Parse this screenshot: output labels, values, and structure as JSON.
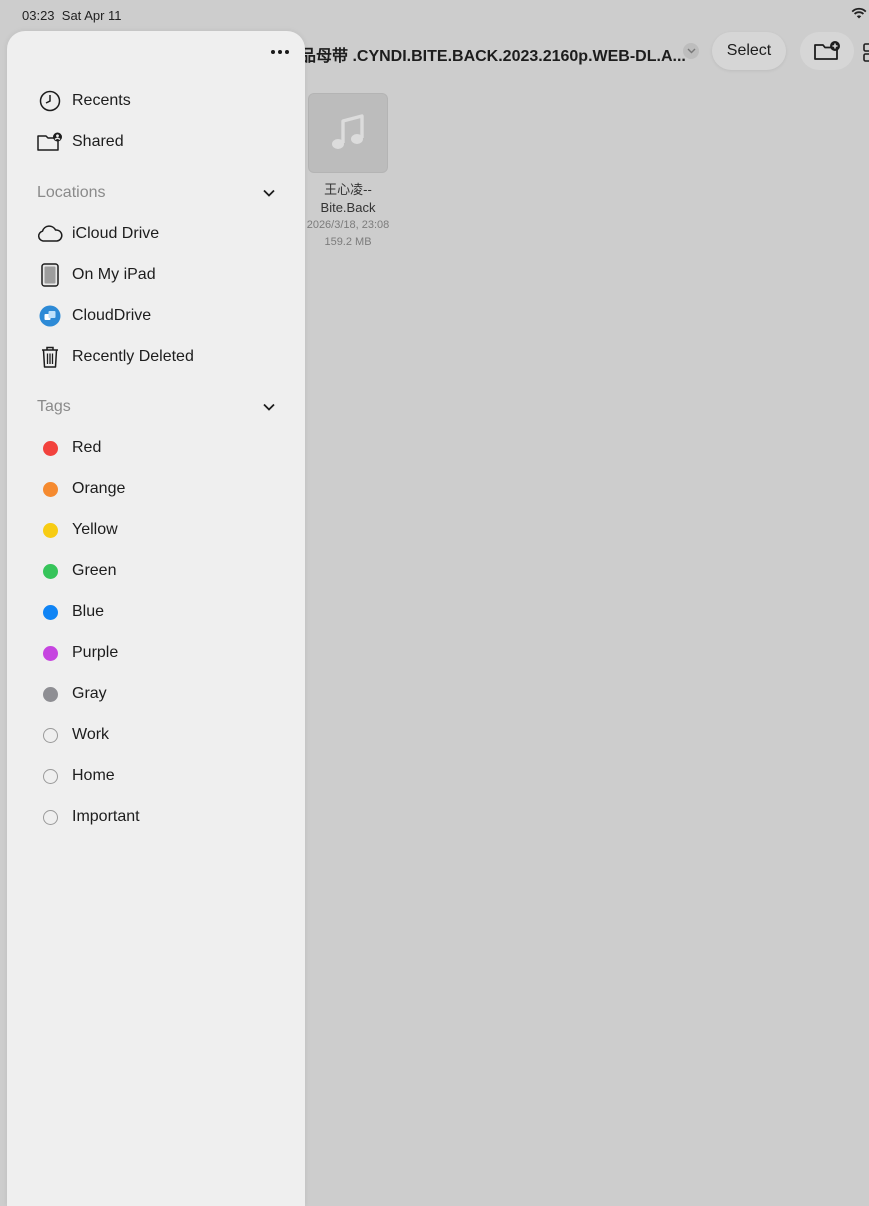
{
  "status_bar": {
    "time": "03:23",
    "date": "Sat Apr 11"
  },
  "header": {
    "path_title": "品母带 .CYNDI.BITE.BACK.2023.2160p.WEB-DL.A...",
    "select_label": "Select"
  },
  "file": {
    "name_line1": "王心凌--",
    "name_line2": "Bite.Back",
    "date": "2026/3/18, 23:08",
    "size": "159.2 MB"
  },
  "sidebar": {
    "top_items": [
      {
        "label": "Recents",
        "icon": "clock-icon"
      },
      {
        "label": "Shared",
        "icon": "shared-folder-icon"
      }
    ],
    "locations_header": "Locations",
    "locations": [
      {
        "label": "iCloud Drive",
        "icon": "cloud-icon"
      },
      {
        "label": "On My iPad",
        "icon": "ipad-icon"
      },
      {
        "label": "CloudDrive",
        "icon": "clouddrive-icon"
      },
      {
        "label": "Recently Deleted",
        "icon": "trash-icon"
      }
    ],
    "tags_header": "Tags",
    "tags": [
      {
        "label": "Red",
        "color": "#f2423d"
      },
      {
        "label": "Orange",
        "color": "#f58a2f"
      },
      {
        "label": "Yellow",
        "color": "#f7cc13"
      },
      {
        "label": "Green",
        "color": "#36c45a"
      },
      {
        "label": "Blue",
        "color": "#0f84f5"
      },
      {
        "label": "Purple",
        "color": "#c645e0"
      },
      {
        "label": "Gray",
        "color": "#8e8e93"
      },
      {
        "label": "Work",
        "color": ""
      },
      {
        "label": "Home",
        "color": ""
      },
      {
        "label": "Important",
        "color": ""
      }
    ]
  }
}
